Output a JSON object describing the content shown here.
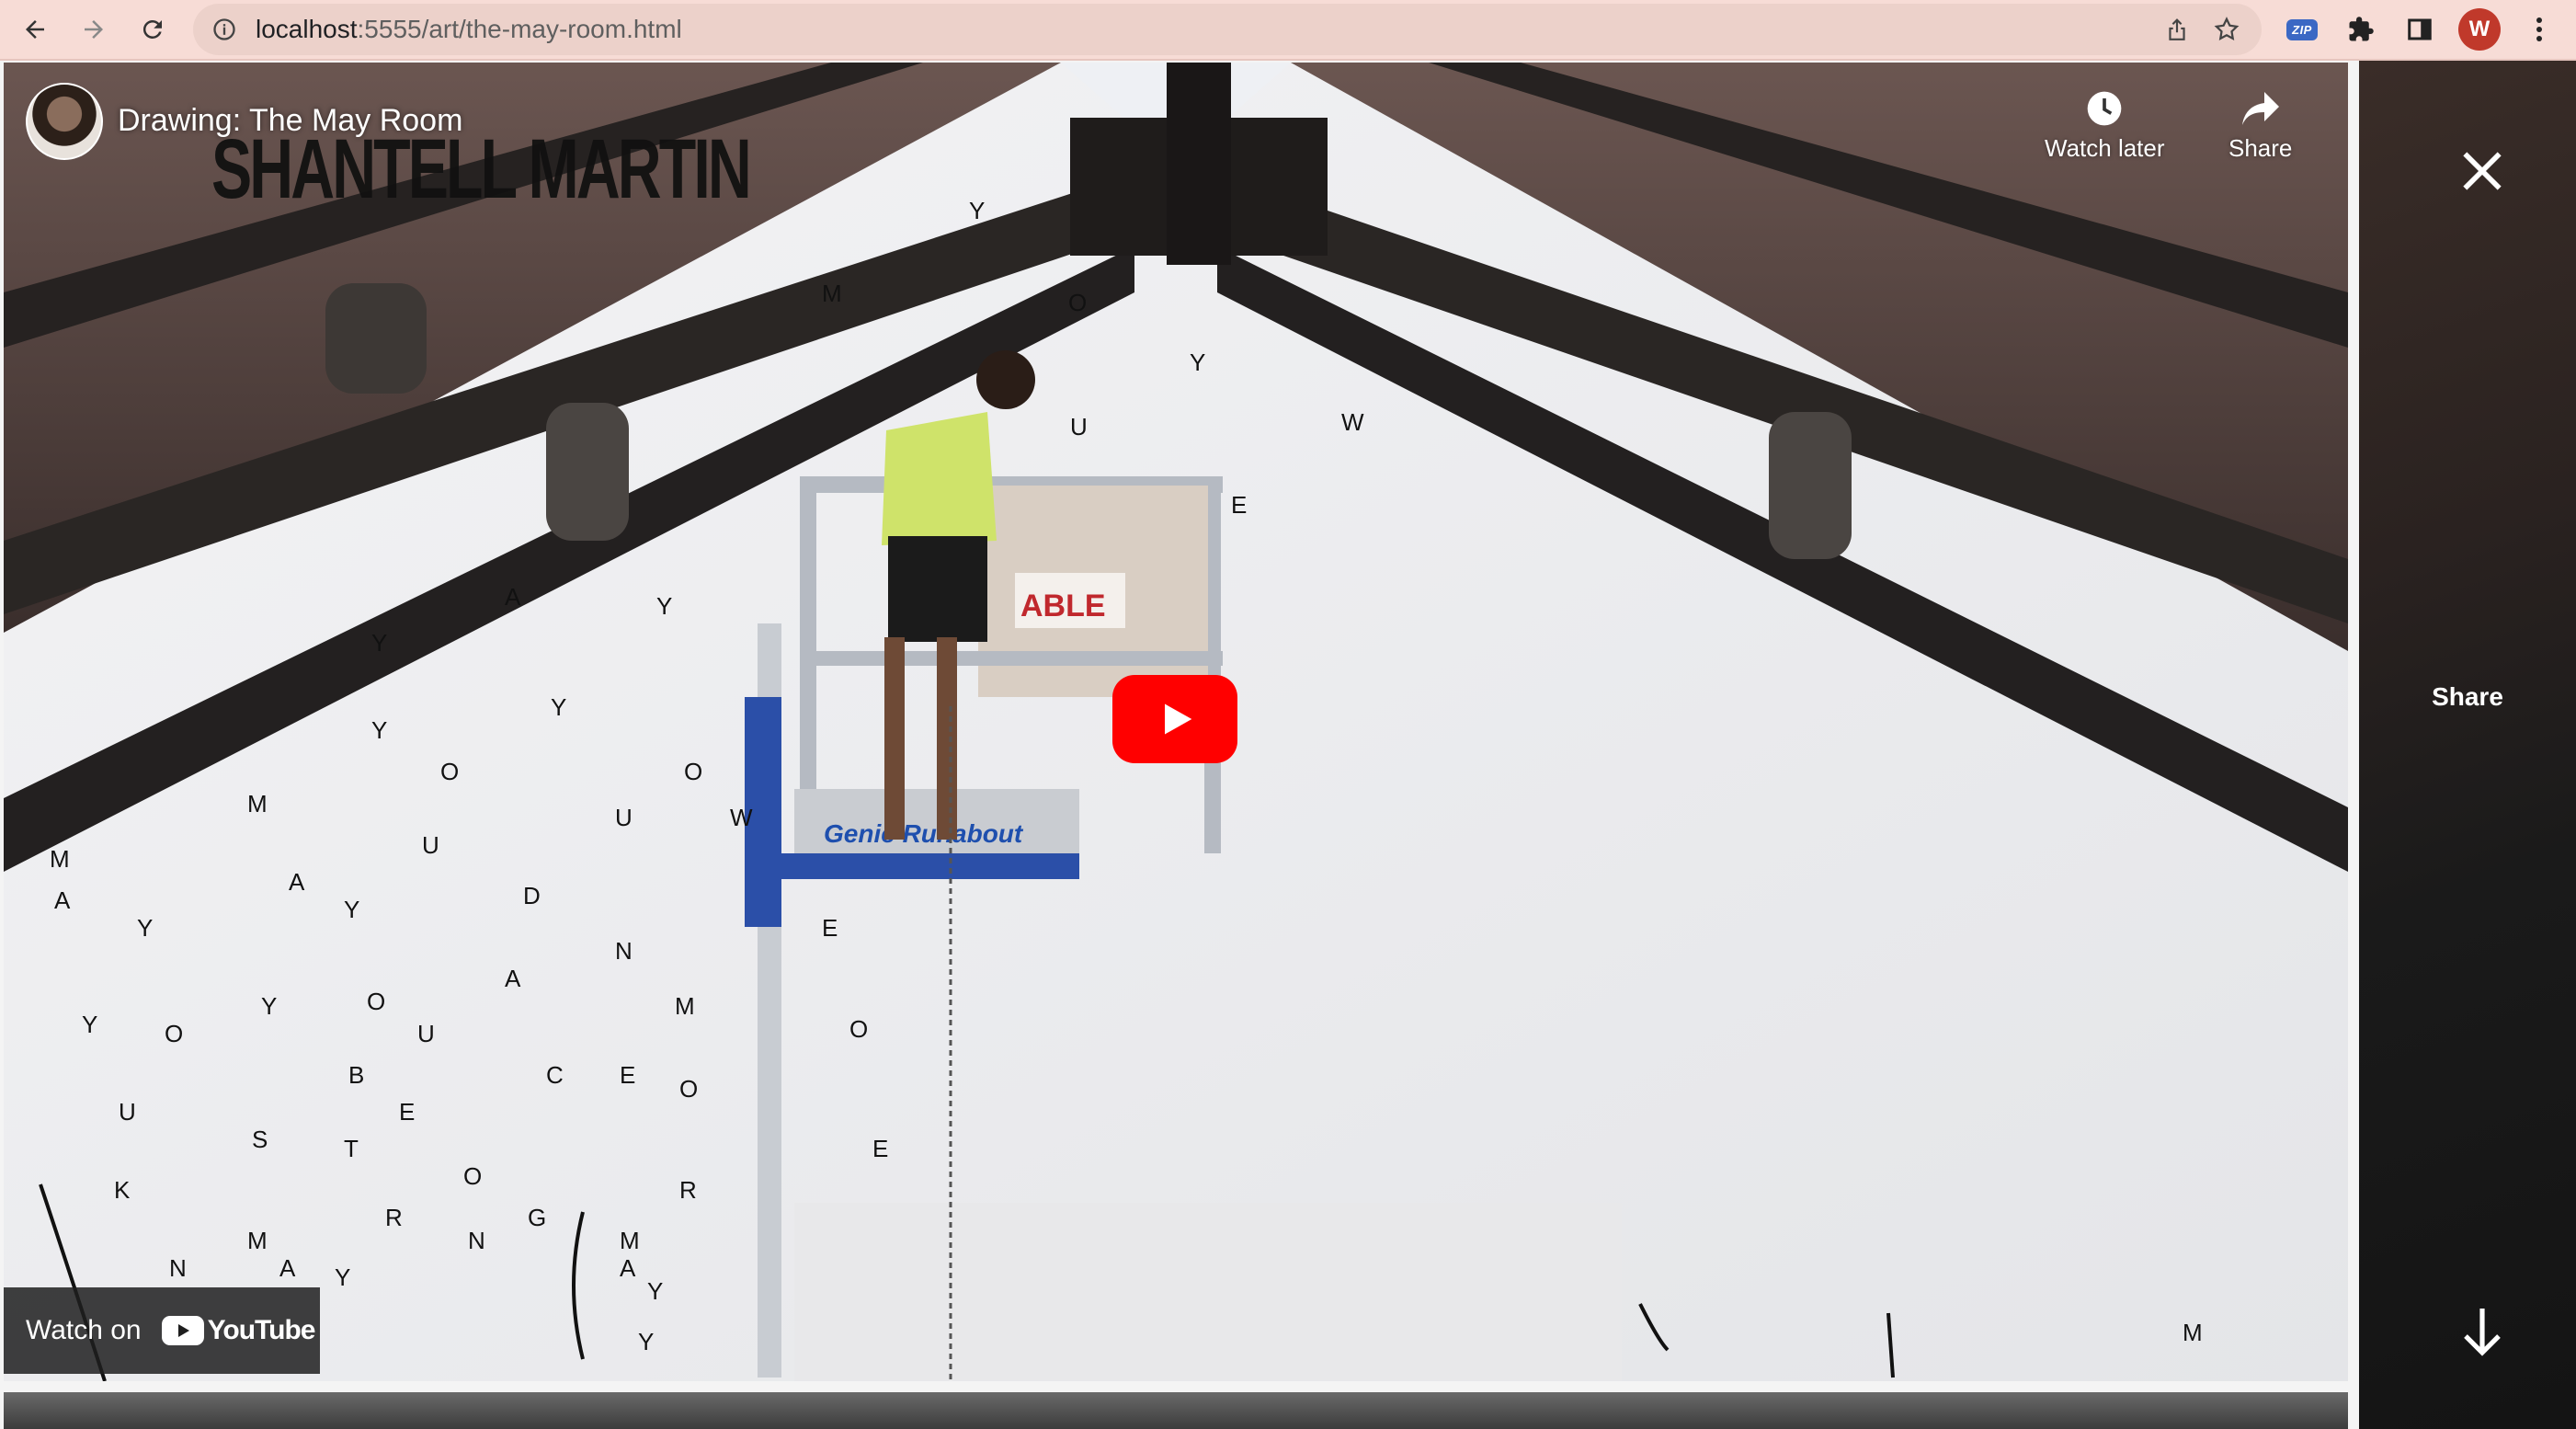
{
  "browser": {
    "url_host": "localhost",
    "url_path": ":5555/art/the-may-room.html",
    "extensions": [
      "zip-extension",
      "puzzle-extension",
      "side-panel"
    ],
    "zip_label": "ZIP",
    "profile_initial": "W"
  },
  "video": {
    "title": "Drawing: The May Room",
    "watch_later_label": "Watch later",
    "share_label": "Share",
    "watch_on_label": "Watch on",
    "youtube_label": "YouTube",
    "brand_overlay": "SHANTELL MARTIN",
    "lift_sign_text": "ABLE",
    "lift_brand": "Genie Runabout"
  },
  "side_panel": {
    "share_label": "Share"
  },
  "colors": {
    "toolbar": "#f7dcd6",
    "omnibox": "#ecd1ca",
    "play_red": "#ff0000",
    "avatar_red": "#c0392b"
  }
}
